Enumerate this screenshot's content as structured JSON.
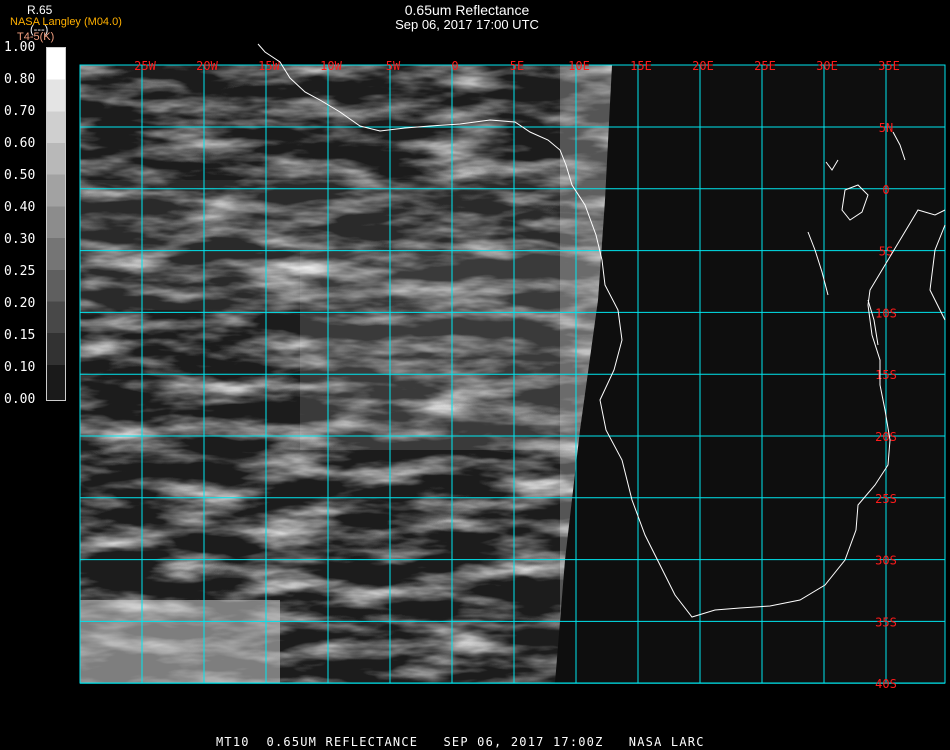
{
  "header": {
    "title": "0.65um Reflectance",
    "subtitle": "Sep 06, 2017 17:00 UTC",
    "provider": "NASA Langley (M04.0)",
    "channel_label": "R.65",
    "units_label": "(---)",
    "secondary_label": "T4-5(K)"
  },
  "colorbar": {
    "labels": [
      "1.00",
      "0.80",
      "0.70",
      "0.60",
      "0.50",
      "0.40",
      "0.30",
      "0.25",
      "0.20",
      "0.15",
      "0.10",
      "0.00"
    ]
  },
  "map": {
    "longitude_labels": [
      "25W",
      "20W",
      "15W",
      "10W",
      "5W",
      "0",
      "5E",
      "10E",
      "15E",
      "20E",
      "25E",
      "30E",
      "35E"
    ],
    "latitude_labels": [
      "5N",
      "0",
      "5S",
      "10S",
      "15S",
      "20S",
      "25S",
      "30S",
      "35S",
      "40S"
    ],
    "grid_color": "#00e5ee",
    "label_color": "#ff1a1a",
    "coast_color": "#ffffff"
  },
  "footer": {
    "caption": "MT10  0.65UM REFLECTANCE   SEP 06, 2017 17:00Z   NASA LARC"
  }
}
